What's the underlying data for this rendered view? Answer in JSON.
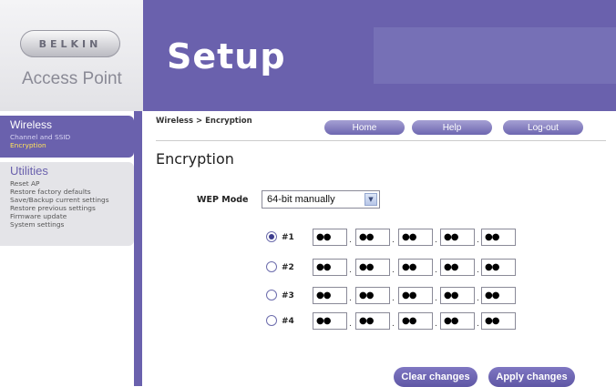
{
  "branding": {
    "logo": "BELKIN",
    "product": "Access Point",
    "title": "Setup"
  },
  "sidebar": {
    "wireless": {
      "title": "Wireless",
      "items": [
        "Channel and SSID",
        "Encryption"
      ]
    },
    "utilities": {
      "title": "Utilities",
      "items": [
        "Reset AP",
        "Restore factory defaults",
        "Save/Backup current settings",
        "Restore previous settings",
        "Firmware update",
        "System settings"
      ]
    }
  },
  "breadcrumb": "Wireless > Encryption",
  "nav": {
    "home": "Home",
    "help": "Help",
    "logout": "Log-out"
  },
  "page_title": "Encryption",
  "wep": {
    "label": "WEP Mode",
    "selected": "64-bit manually"
  },
  "keys": [
    {
      "label": "#1",
      "selected": true,
      "bytes": [
        "●●",
        "●●",
        "●●",
        "●●",
        "●●"
      ]
    },
    {
      "label": "#2",
      "selected": false,
      "bytes": [
        "●●",
        "●●",
        "●●",
        "●●",
        "●●"
      ]
    },
    {
      "label": "#3",
      "selected": false,
      "bytes": [
        "●●",
        "●●",
        "●●",
        "●●",
        "●●"
      ]
    },
    {
      "label": "#4",
      "selected": false,
      "bytes": [
        "●●",
        "●●",
        "●●",
        "●●",
        "●●"
      ]
    }
  ],
  "actions": {
    "clear": "Clear changes",
    "apply": "Apply changes"
  },
  "colors": {
    "brand": "#6a61ad",
    "highlight": "#ffe25a"
  }
}
